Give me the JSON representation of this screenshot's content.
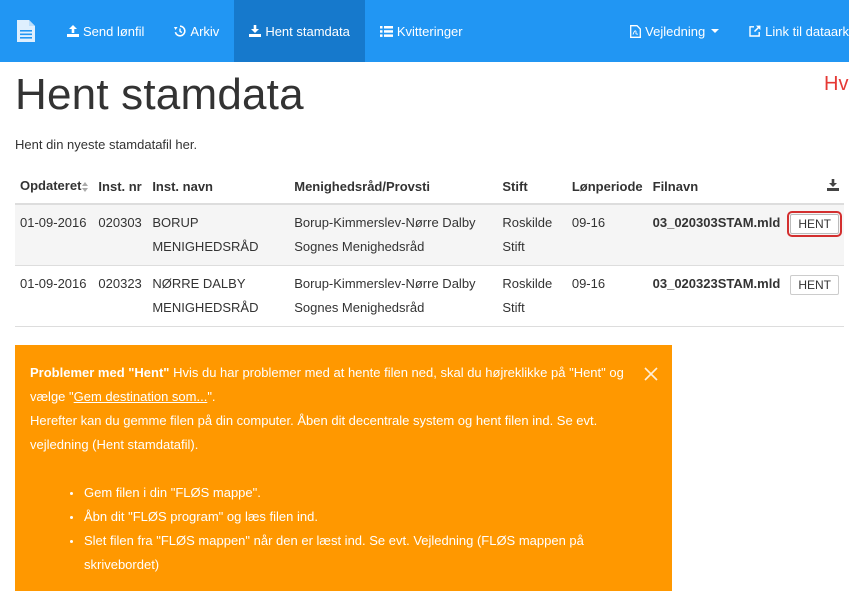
{
  "nav": {
    "brand_icon": "document-icon",
    "items": [
      {
        "label": "Send lønfil",
        "icon": "upload-icon"
      },
      {
        "label": "Arkiv",
        "icon": "history-icon"
      },
      {
        "label": "Hent stamdata",
        "icon": "download-icon",
        "active": true
      },
      {
        "label": "Kvitteringer",
        "icon": "list-icon"
      }
    ],
    "right": [
      {
        "label": "Vejledning",
        "icon": "file-pdf-icon",
        "dropdown": true
      },
      {
        "label": "Link til dataark",
        "icon": "external-link-icon"
      }
    ],
    "colors": {
      "bar": "#2196f3",
      "active": "#1679cc"
    }
  },
  "page": {
    "title": "Hent stamdata",
    "edge_text": "Hv",
    "intro": "Hent din nyeste stamdatafil her."
  },
  "table": {
    "headers": [
      "Opdateret",
      "Inst. nr",
      "Inst. navn",
      "Menighedsråd/Provsti",
      "Stift",
      "Lønperiode",
      "Filnavn"
    ],
    "download_header_icon": "download-icon",
    "rows": [
      {
        "date": "01-09-2016",
        "inst_nr": "020303",
        "inst_navn": "BORUP MENIGHEDSRÅD",
        "menighedsraad": "Borup-Kimmerslev-Nørre Dalby Sognes Menighedsråd",
        "stift": "Roskilde Stift",
        "loenperiode": "09-16",
        "filnavn": "03_020303STAM.mld",
        "button": "HENT"
      },
      {
        "date": "01-09-2016",
        "inst_nr": "020323",
        "inst_navn": "NØRRE DALBY MENIGHEDSRÅD",
        "menighedsraad": "Borup-Kimmerslev-Nørre Dalby Sognes Menighedsråd",
        "stift": "Roskilde Stift",
        "loenperiode": "09-16",
        "filnavn": "03_020323STAM.mld",
        "button": "HENT"
      }
    ]
  },
  "alert": {
    "color": "#ff9800",
    "title": "Problemer med \"Hent\"",
    "text1": " Hvis du har problemer med at hente filen ned, skal du højreklikke på \"Hent\" og vælge \"",
    "link": "Gem destination som...",
    "text2": "\".",
    "text3": "Herefter kan du gemme filen på din computer. Åben dit decentrale system og hent filen ind. Se evt. vejledning (Hent stamdatafil).",
    "bullets": [
      "Gem filen i din \"FLØS mappe\".",
      "Åbn dit \"FLØS program\" og læs filen ind.",
      "Slet filen fra \"FLØS mappen\" når den er læst ind. Se evt. Vejledning (FLØS mappen på skrivebordet)"
    ]
  }
}
